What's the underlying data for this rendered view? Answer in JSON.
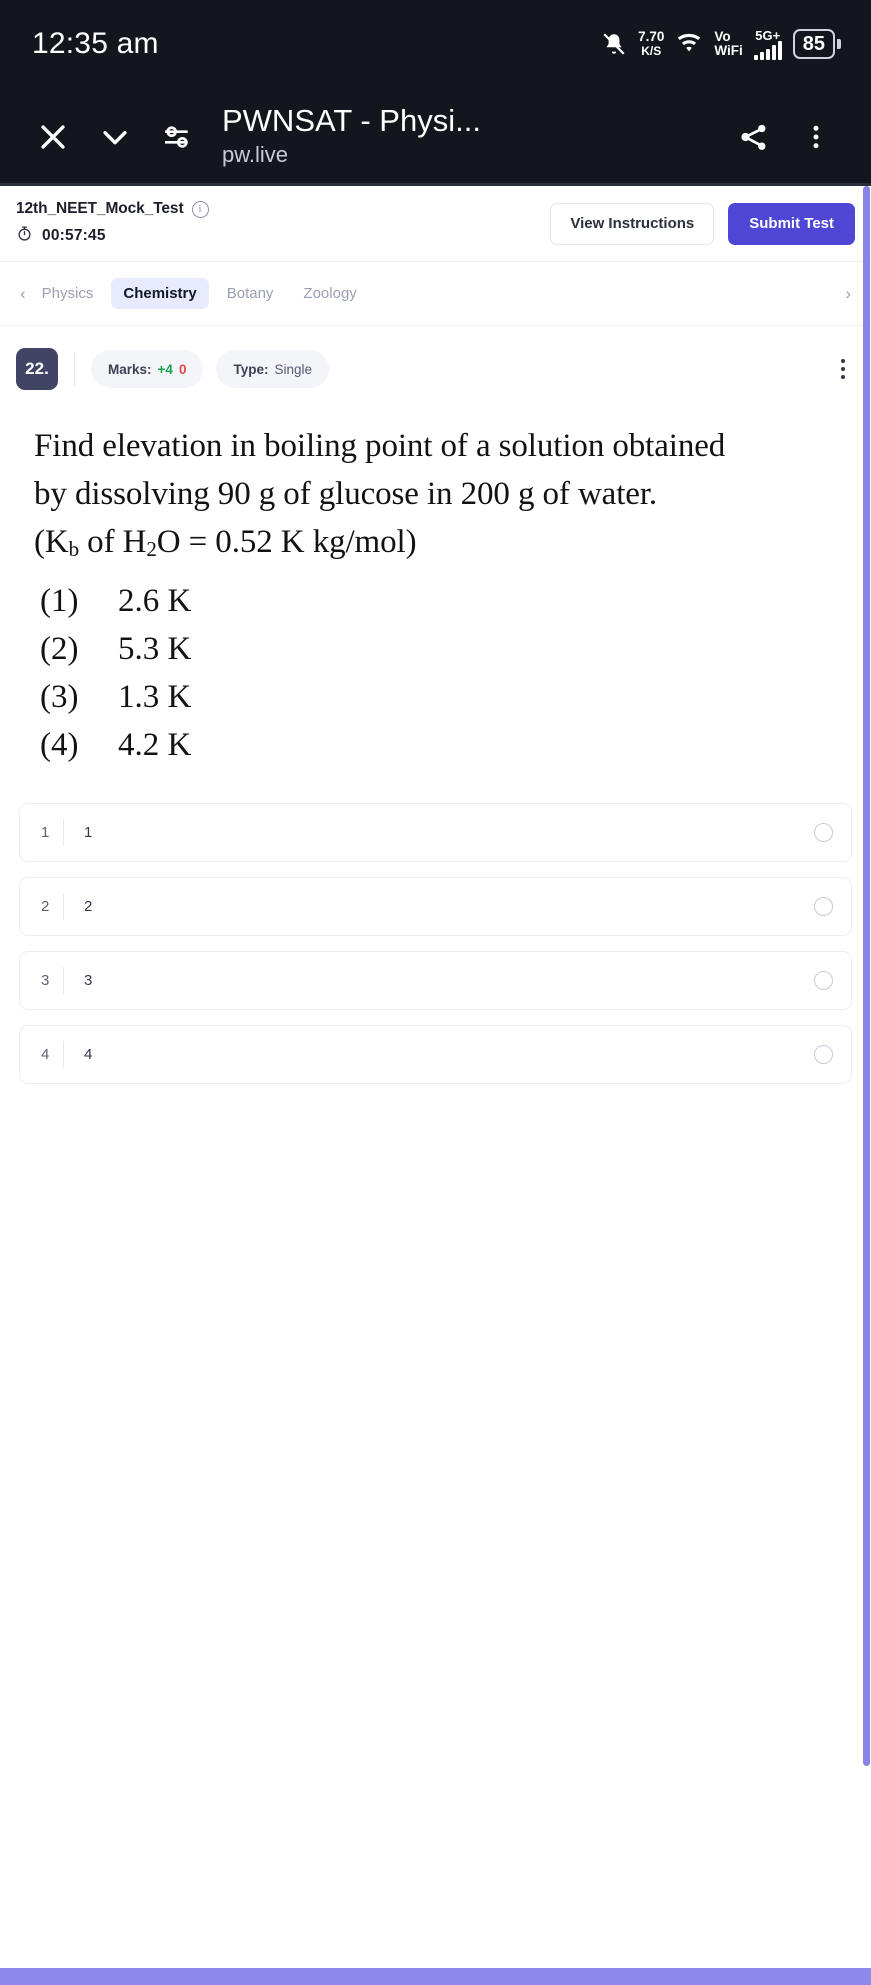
{
  "statusbar": {
    "clock": "12:35 am",
    "bell_icon": "bell-muted-icon",
    "net_speed_value": "7.70",
    "net_speed_unit": "K/S",
    "wifi_icon": "wifi-icon",
    "vowifi_line1": "Vo",
    "vowifi_line2": "WiFi",
    "network_type": "5G+",
    "signal_icon": "signal-bars-icon",
    "battery_level": "85"
  },
  "browser_bar": {
    "close_icon": "close-icon",
    "chevron_icon": "chevron-down-icon",
    "tune_icon": "tune-sliders-icon",
    "title": "PWNSAT - Physi...",
    "url": "pw.live",
    "share_icon": "share-icon",
    "overflow_icon": "more-vertical-icon"
  },
  "test_header": {
    "test_name": "12th_NEET_Mock_Test",
    "info_icon": "info-icon",
    "timer_icon": "stopwatch-icon",
    "timer": "00:57:45",
    "view_instructions_label": "View Instructions",
    "submit_label": "Submit Test",
    "primary_color": "#4f46d6"
  },
  "subject_tabs": {
    "prev_icon": "chevron-left-icon",
    "next_icon": "chevron-right-icon",
    "items": [
      {
        "label": "Physics",
        "active": false
      },
      {
        "label": "Chemistry",
        "active": true
      },
      {
        "label": "Botany",
        "active": false
      },
      {
        "label": "Zoology",
        "active": false
      }
    ]
  },
  "question": {
    "number": "22.",
    "marks_label": "Marks:",
    "marks_positive": "+4",
    "marks_negative": "0",
    "type_label": "Type:",
    "type_value": "Single",
    "menu_icon": "more-vertical-icon",
    "text_lines": [
      "Find elevation in boiling point of a solution obtained",
      "by dissolving 90 g of glucose in 200 g of water."
    ],
    "formula_prefix": "(K",
    "formula_sub1": "b",
    "formula_mid": " of H",
    "formula_sub2": "2",
    "formula_tail": "O = 0.52 K kg/mol)",
    "options": [
      {
        "index": "(1)",
        "text": "2.6 K"
      },
      {
        "index": "(2)",
        "text": "5.3 K"
      },
      {
        "index": "(3)",
        "text": "1.3 K"
      },
      {
        "index": "(4)",
        "text": "4.2 K"
      }
    ]
  },
  "answer_rows": [
    {
      "index": "1",
      "label": "1",
      "selected": false
    },
    {
      "index": "2",
      "label": "2",
      "selected": false
    },
    {
      "index": "3",
      "label": "3",
      "selected": false
    },
    {
      "index": "4",
      "label": "4",
      "selected": false
    }
  ],
  "scrollbar": {
    "color": "#8984e8"
  },
  "bottom_bar": {
    "color": "#8d89ea"
  }
}
